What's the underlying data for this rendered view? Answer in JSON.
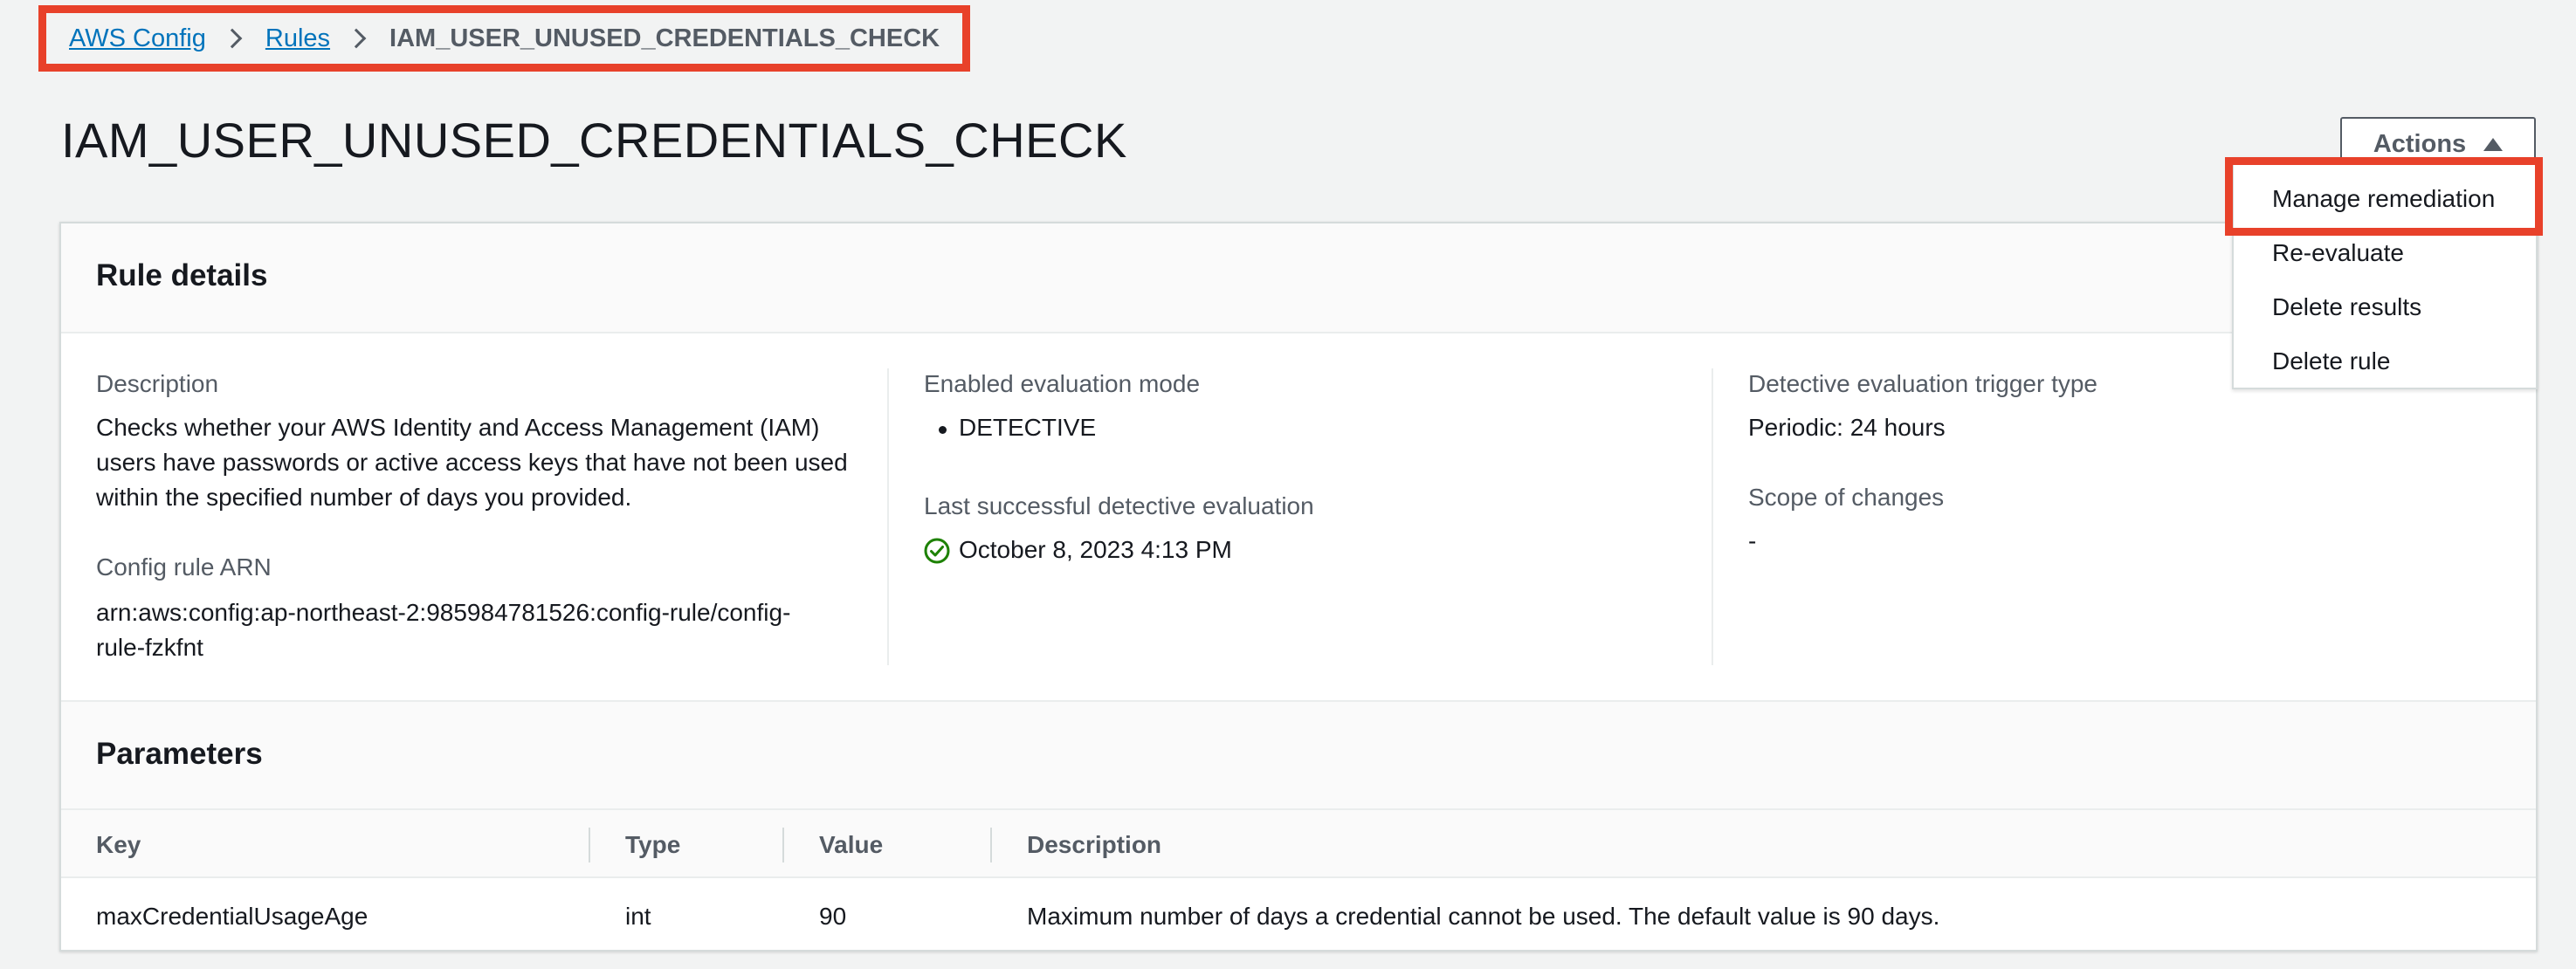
{
  "breadcrumb": {
    "root": "AWS Config",
    "parent": "Rules",
    "current": "IAM_USER_UNUSED_CREDENTIALS_CHECK"
  },
  "page_title": "IAM_USER_UNUSED_CREDENTIALS_CHECK",
  "actions": {
    "label": "Actions",
    "menu_items": [
      "Manage remediation",
      "Re-evaluate",
      "Delete results",
      "Delete rule"
    ]
  },
  "rule_details": {
    "title": "Rule details",
    "description_label": "Description",
    "description_lines": [
      "Checks whether your AWS Identity and Access Management (IAM)",
      "users have passwords or active access keys that have not been used",
      "within the specified number of days you provided."
    ],
    "arn_label": "Config rule ARN",
    "arn_lines": [
      "arn:aws:config:ap-northeast-2:985984781526:config-rule/config-",
      "rule-fzkfnt"
    ],
    "eval_mode_label": "Enabled evaluation mode",
    "eval_mode_value": "DETECTIVE",
    "last_eval_label": "Last successful detective evaluation",
    "last_eval_value": "October 8, 2023 4:13 PM",
    "trigger_label": "Detective evaluation trigger type",
    "trigger_value": "Periodic: 24 hours",
    "scope_label": "Scope of changes",
    "scope_value": "-"
  },
  "parameters": {
    "title": "Parameters",
    "columns": [
      "Key",
      "Type",
      "Value",
      "Description"
    ],
    "rows": [
      {
        "key": "maxCredentialUsageAge",
        "type": "int",
        "value": "90",
        "description": "Maximum number of days a credential cannot be used. The default value is 90 days."
      }
    ]
  },
  "colors": {
    "link": "#0073bb",
    "highlight": "#e8412a",
    "success": "#1d8102",
    "background": "#f2f3f3"
  }
}
